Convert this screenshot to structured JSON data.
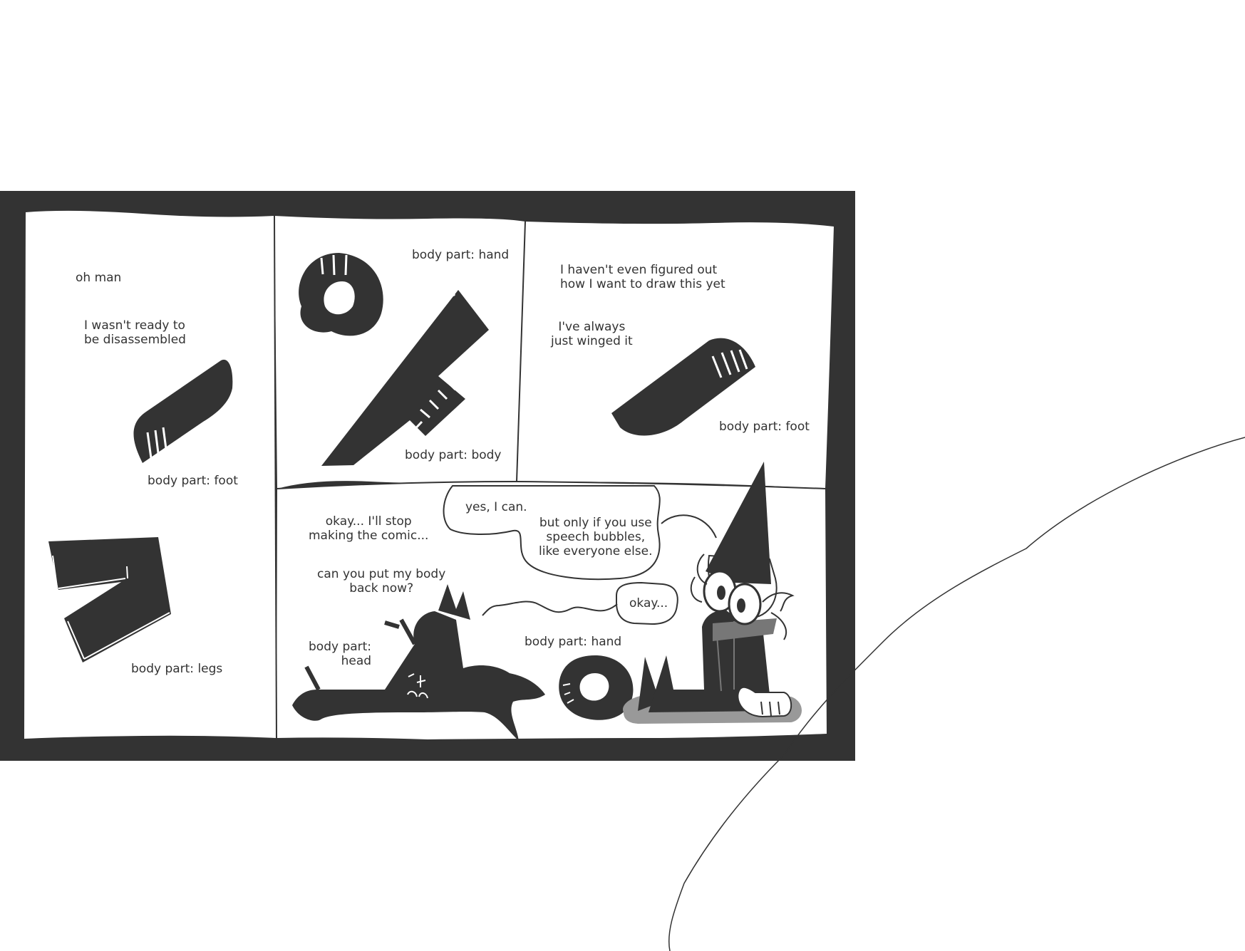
{
  "colors": {
    "ink": "#333333",
    "paper": "#ffffff",
    "shadow": "#999999",
    "scarf": "#777777"
  },
  "panel1": {
    "line1": "oh man",
    "line2": "I wasn't ready to\nbe disassembled",
    "foot_label": "body part: foot",
    "legs_label": "body part: legs"
  },
  "panel2": {
    "hand_label": "body part: hand",
    "body_label": "body part: body"
  },
  "panel3": {
    "line1": "I haven't even figured out\nhow I want to draw this yet",
    "line2": "I've always\njust winged it",
    "foot_label": "body part: foot"
  },
  "panel4": {
    "line1": "okay... I'll stop\nmaking the comic...",
    "line2": "can you put my body\nback now?",
    "head_label": "body part:\nhead",
    "hand_label": "body part: hand",
    "bubble1": "yes, I can.",
    "bubble2": "but only if you use\nspeech bubbles,\nlike everyone else.",
    "bubble3": "okay..."
  },
  "icons": [
    "hand-icon",
    "body-icon",
    "foot-icon",
    "legs-icon",
    "head-icon",
    "wizard-character"
  ]
}
